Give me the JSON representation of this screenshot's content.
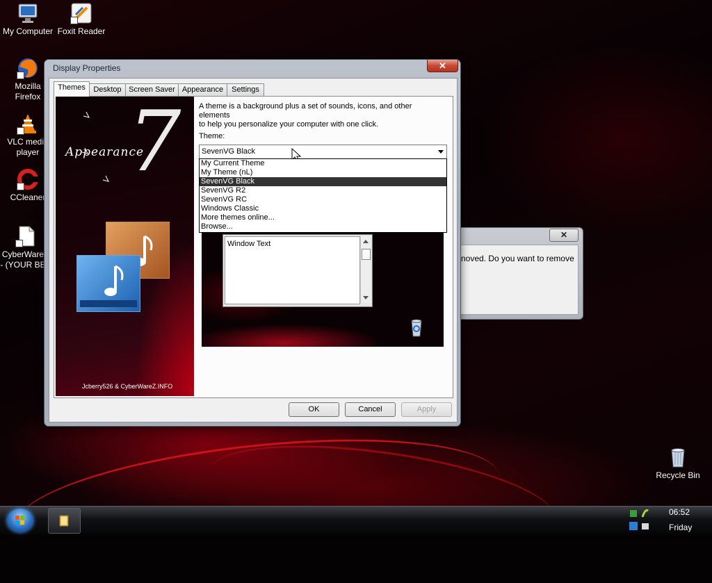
{
  "desktop": {
    "icons": [
      {
        "label": "My Computer",
        "icon": "monitor-icon"
      },
      {
        "label": "Foxit Reader",
        "icon": "pdf-reader-icon"
      },
      {
        "label": "Mozilla Firefox",
        "line1": "Mozilla",
        "line2": "Firefox",
        "icon": "firefox-icon"
      },
      {
        "label": "VLC media player",
        "line1": "VLC media",
        "line2": "player",
        "icon": "vlc-cone-icon"
      },
      {
        "label": "CCleaner",
        "icon": "ccleaner-icon"
      },
      {
        "label": "CyberWare... - (YOUR BE...",
        "line1": "CyberWare...",
        "line2": "- (YOUR BE...",
        "icon": "document-icon"
      },
      {
        "label": "Recycle Bin",
        "icon": "recycle-bin-icon"
      }
    ]
  },
  "dialog": {
    "title": "Display Properties",
    "close_label": "✕",
    "tabs": [
      {
        "label": "Themes",
        "active": true
      },
      {
        "label": "Desktop",
        "active": false
      },
      {
        "label": "Screen Saver",
        "active": false
      },
      {
        "label": "Appearance",
        "active": false
      },
      {
        "label": "Settings",
        "active": false
      }
    ],
    "preview": {
      "title": "Appearance",
      "numeral": "7",
      "credit": "Jcberry526 & CyberWareZ.INFO"
    },
    "description_line1": "A theme is a background plus a set of sounds, icons, and other elements",
    "description_line2": "to help you personalize your computer with one click.",
    "theme_label": "Theme:",
    "theme_value": "SevenVG Black",
    "theme_options": [
      {
        "label": "My Current Theme",
        "selected": false
      },
      {
        "label": "My Theme (nL)",
        "selected": false
      },
      {
        "label": "SevenVG Black",
        "selected": true
      },
      {
        "label": "SevenVG R2",
        "selected": false
      },
      {
        "label": "SevenVG RC",
        "selected": false
      },
      {
        "label": "Windows Classic",
        "selected": false
      },
      {
        "label": "More themes online...",
        "selected": false
      },
      {
        "label": "Browse...",
        "selected": false
      }
    ],
    "sample_window_text": "Window Text",
    "buttons": {
      "ok": "OK",
      "cancel": "Cancel",
      "apply": "Apply"
    }
  },
  "background_dialog": {
    "close_label": "✕",
    "text": "noved.  Do you want to remove"
  },
  "taskbar": {
    "time": "06:52",
    "day": "Friday"
  },
  "colors": {
    "selection": "#333333",
    "accent_red": "#c8001e"
  }
}
